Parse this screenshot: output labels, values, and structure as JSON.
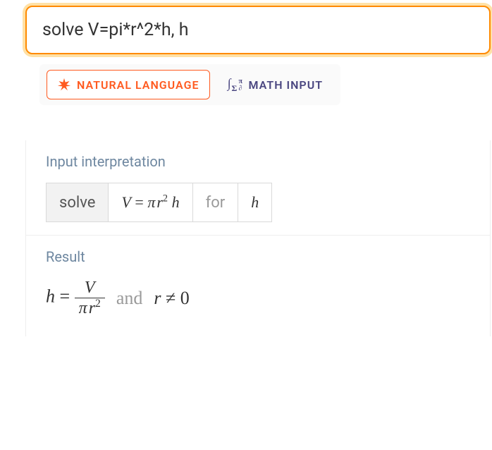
{
  "search": {
    "value": "solve V=pi*r^2*h, h"
  },
  "tabs": {
    "natural": "NATURAL LANGUAGE",
    "math": "MATH INPUT"
  },
  "sections": {
    "interp_title": "Input interpretation",
    "result_title": "Result"
  },
  "interp": {
    "solve": "solve",
    "for": "for",
    "var": "h",
    "eq_V": "V",
    "eq_equals": " = ",
    "eq_pi": "π",
    "eq_r": "r",
    "eq_exp": "2",
    "eq_h": " h"
  },
  "result": {
    "lhs": "h",
    "equals": " = ",
    "num": "V",
    "den_pi": "π",
    "den_r": "r",
    "den_exp": "2",
    "and": "and",
    "cond_r": "r",
    "neq": " ≠ ",
    "zero": "0"
  }
}
